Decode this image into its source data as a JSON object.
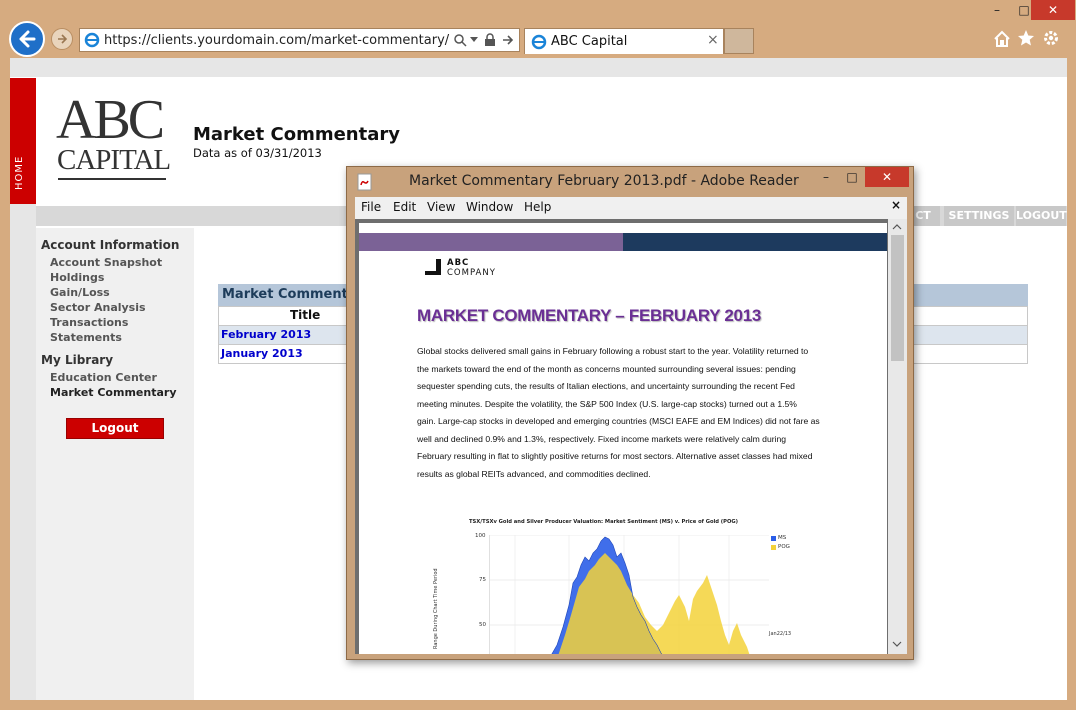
{
  "browser": {
    "url": "https://clients.yourdomain.com/market-commentary/",
    "tab_title": "ABC Capital",
    "tab_close": "×",
    "win_minimize": "–",
    "win_maximize": "□",
    "win_close": "✕"
  },
  "site": {
    "home_label": "HOME",
    "logo_line1": "ABC",
    "logo_line2": "CAPITAL",
    "page_title": "Market Commentary",
    "data_as_of": "Data as of 03/31/2013",
    "top_menu": [
      "CT",
      "SETTINGS",
      "LOGOUT"
    ],
    "sidebar": {
      "account_heading": "Account Information",
      "account_items": [
        "Account Snapshot",
        "Holdings",
        "Gain/Loss",
        "Sector Analysis",
        "Transactions",
        "Statements"
      ],
      "library_heading": "My Library",
      "library_items": [
        "Education Center",
        "Market Commentary"
      ],
      "logout_label": "Logout"
    },
    "table": {
      "heading": "Market Commentar",
      "column_title": "Title",
      "rows": [
        "February 2013",
        "January 2013"
      ]
    }
  },
  "pdf_window": {
    "title": "Market Commentary February 2013.pdf - Adobe Reader",
    "menu": [
      "File",
      "Edit",
      "View",
      "Window",
      "Help"
    ],
    "close_doc": "×",
    "doc": {
      "company_line1": "ABC",
      "company_line2": "COMPANY",
      "heading": "MARKET COMMENTARY – FEBRUARY 2013",
      "body_lines": [
        "Global stocks delivered small gains in February following a robust start to the year. Volatility returned to",
        "the markets toward the end of the month as concerns mounted surrounding several issues: pending",
        "sequester spending cuts, the results of Italian elections, and uncertainty surrounding the recent Fed",
        "meeting minutes. Despite the volatility, the S&P 500 Index (U.S. large-cap stocks) turned out a 1.5%",
        "gain. Large-cap stocks in developed and emerging countries (MSCI EAFE and EM Indices) did not fare as",
        "well and declined 0.9% and 1.3%, respectively. Fixed income markets were relatively calm during",
        "February resulting in flat to slightly positive returns for most sectors. Alternative asset classes had mixed",
        "results as global REITs advanced, and commodities declined."
      ],
      "chart_title": "TSX/TSXv Gold and Silver Producer Valuation: Market Sentiment (MS) v. Price of Gold (POG)",
      "chart_ylabel": "Range During Chart Time Period",
      "chart_ticks": [
        "100",
        "75",
        "50"
      ],
      "legend": [
        "MS",
        "POG"
      ],
      "end_label": "Jan22/13"
    }
  },
  "colors": {
    "accent_red": "#cc0000",
    "link_blue": "#0000cc",
    "pdf_purple": "#7b6296",
    "pdf_navy": "#1d3a5e",
    "heading_purple": "#6a2f94",
    "ms_blue": "#2b5ee8",
    "pog_yellow": "#f3d23a"
  }
}
